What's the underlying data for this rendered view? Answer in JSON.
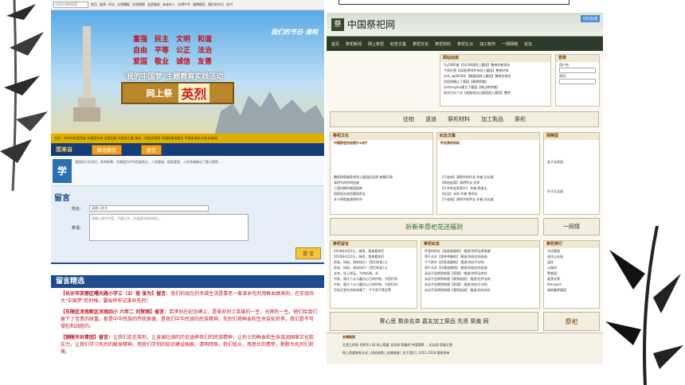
{
  "left_site": {
    "nav_search_placeholder": "中国文明网搜索",
    "nav_links": [
      "首页",
      "要闻",
      "评论",
      "文明播报",
      "文明观察",
      "志愿服务",
      "未成年人",
      "文明中华",
      "道德模范",
      "我们的节日",
      "读书",
      "视频",
      "资料",
      "微博"
    ],
    "values": [
      [
        "富强",
        "民主",
        "文明",
        "和谐"
      ],
      [
        "自由",
        "平等",
        "公正",
        "法治"
      ],
      [
        "爱国",
        "敬业",
        "诚信",
        "友善"
      ]
    ],
    "holiday": "我们的节日·清明",
    "dream": "\"我的中国梦\"主题教育实践活动",
    "board_prefix": "网上祭",
    "board_main": "英烈",
    "org_bar": "主办：中共中央宣传部 共青团中央 全国妇联 中国关工委   承办：中国文明网 中国网络电视台 中国未成年人网 未来网",
    "action_label": "您来自",
    "action_btn1": "献花献花",
    "action_btn2": "留言",
    "xue_badge": "学",
    "xue_text": "我国伟大先烈们，革命前辈，共和国为中华民族独立、人民解放、国家富强、人民幸福做出了重大牺牲……",
    "msg_title": "留言",
    "form_name_label": "姓名：",
    "form_name_value": "请输入姓名",
    "form_content_label": "寄语：",
    "form_content_placeholder": "请输入留言内容，不超过字，并请遵守相关规定。",
    "submit": "提 交",
    "picks_title": "留言精选",
    "picks": [
      {
        "who": "【长沙市芙蓉区曙光路小学三（3）班 张为】留言：",
        "text": "我们的现在的幸福生活是靠老一辈革命先烈用鲜血换来的，在实现伟大\"中国梦\"的时候，要始终牢记革命先烈！"
      },
      {
        "who": "【东陵区浑南新区浑南四小 六年二 刘贺雨】留言：",
        "text": "若李别在纪念碑上，是革命烈士英雄的一生，光辉的一生。他们给我们留下了宝贵的财富，那是中华民族的传统美德，是我们中华民族的民族精神。先烈们用鲜血和生命告知世界，我们是不可侵犯和战胜的。"
      },
      {
        "who": "【铜陵市共青团】留言：",
        "text": "让我们走近英烈，让波澜壮阔的历史涵养我们的民族精神，让烈士的鲜血和生命滋润国家文化软实力，让我们学习先烈的献身精神，用我们学到的知识建设国家。清明拜祭，我们低头，用思仕的情怀，默默为先烈们祈祷。"
      }
    ]
  },
  "right_site": {
    "title": "中国祭祀网",
    "seal": "祭",
    "qq": "QQ在线",
    "menu": [
      "首页",
      "祭祀新闻",
      "网上祭祀",
      "纪念文集",
      "祭祀文化",
      "祭祀材料",
      "祭祀礼仪",
      "加工制作",
      "一网网络",
      "论坛",
      "留言板"
    ],
    "news_title": "网站动态",
    "news": [
      "Gy1960留【Gy1960网上墓园】整修好新排名",
      "千纸叶馆【仙境/将帅作伟网上墓园】整修好排",
      "yhd_xg0618在【殿殿园网上墓园】整修好排名",
      "民俗阴婚让了墓园【墓碑祭奠】",
      "ylzhongmu建立了墓园【周山林李娟】",
      "老实巴交人在【谁能说出山颖园网上墓园】整修"
    ],
    "login_title": "登录",
    "login_user": "用户名：",
    "login_pass": "密码：",
    "strip1": [
      "往柏",
      "遗道",
      "祭祀材料",
      "加工製品",
      "祭祀"
    ],
    "panel1_title": "祭祀文化",
    "panel1_head": "中国那些民俗是什么的?",
    "panel1_items": [
      "鹏程网祭奠革命烈士颖园纪念馆 查看81条",
      "清明节的时间由来",
      "三国时期的颖园园林",
      "国家阳光进民颖园家长",
      "关于网祭奠清明时节"
    ],
    "panel2_title": "纪念文集",
    "panel2_head": "怀念我的妈妈",
    "panel2_items": [
      "【干爸爸】清明节的怀念 作者:吕长斌",
      "【网站档案】清明怀念 文库",
      "【千岁的长寿家乡】 作者:杨老太",
      "【纪念】本网 作者:李四丰",
      "【干爸爸】清明节的怀念 作者:吕长斌"
    ],
    "panel3_title": "网祭园",
    "panel3_items": [
      "老子长寿园",
      "孙子兵法园"
    ],
    "strip2": "祈新年祭祀花送福到",
    "strip3": "一网情",
    "panel4_title": "祭祀留言",
    "panel4_items": [
      "2018年4月2日，继续，我来看你们",
      "2018年4月2日，继续，我来看你们",
      "愿爸，妈妈，周末快乐！(您们的女儿)",
      "愿爸，妈妈，周末快乐！(您们的女儿)",
      "去年，这上祥云，为你祈祷，永",
      "中秋，隔几个从与嘉内心已的护地，为您们所",
      "中秋，隔几个从与嘉内心已的护地，为您们所",
      "写给天堂先宗的亲属了，千千纸干祭品等"
    ],
    "panel5_title": "祭祀纪念",
    "panel5_items": [
      "怀悲你的在【爸爸周墓地】 细述(你怀念养高感",
      "郑千天孙【我爷爷墓地】 细述(你现在的爸爸",
      "千千纸叶【孙家清墓地】 细述(你在不对吗",
      "郑千天孙【孙建波墓地】 细述(你现在的爸爸",
      "永远不会倒到地理【家理】 细述(你怀念的在",
      "永远不会倒到地理【我到爸爸】 细述(在怀念的",
      "永远不会倒到地理【家理】 细述(你在不对吗",
      "永远不会倒到地理【我到爸爸】 细述(你在的在"
    ],
    "panel6_title": "祭祀排行",
    "panel6_items": [
      "许氏墓园",
      "张氏山水园",
      "温氏",
      "以族风",
      "寒食园",
      "爱拜文祭",
      "Kleviopic",
      "湖南春梦墓园"
    ],
    "strip4": "寄心思 剩余名单 嘉友加工祭品 先贤 祭奠 网",
    "strip5": "祭祀",
    "footer_title": "友情链接",
    "footer_links": "天堂之桥网 世界华人网 网上祭奠 北京网 祭奠网 中国殡葬 ... 纪念网 祭奠天堂",
    "footer_copy": "网上祭奠联系方式 | 网站地图 | 友情链接 | 关于我们 | 2011-2018 版权所有"
  }
}
